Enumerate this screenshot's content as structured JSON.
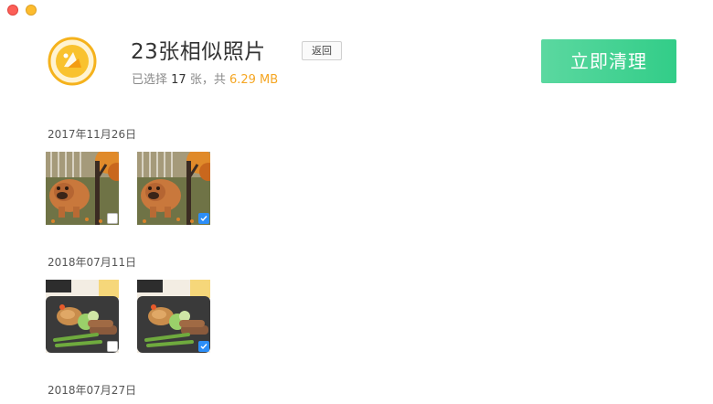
{
  "window": {
    "controls": [
      "close",
      "minimize"
    ]
  },
  "header": {
    "title": "23张相似照片",
    "back_label": "返回",
    "subtitle_prefix": "已选择 ",
    "selected_count": "17",
    "subtitle_mid": " 张，共 ",
    "total_size": "6.29 MB",
    "clean_label": "立即清理"
  },
  "groups": [
    {
      "date": "2017年11月26日",
      "photos": [
        {
          "subject": "dog-under-tree",
          "checked": false
        },
        {
          "subject": "dog-under-tree",
          "checked": true
        }
      ]
    },
    {
      "date": "2018年07月11日",
      "photos": [
        {
          "subject": "food-plate",
          "checked": false
        },
        {
          "subject": "food-plate",
          "checked": true
        }
      ]
    },
    {
      "date": "2018年07月27日",
      "photos": []
    }
  ],
  "colors": {
    "accent_green": "#32cd88",
    "size_orange": "#f5a623",
    "checkbox_blue": "#2c8ef8",
    "icon_yellow": "#f5b21c"
  }
}
